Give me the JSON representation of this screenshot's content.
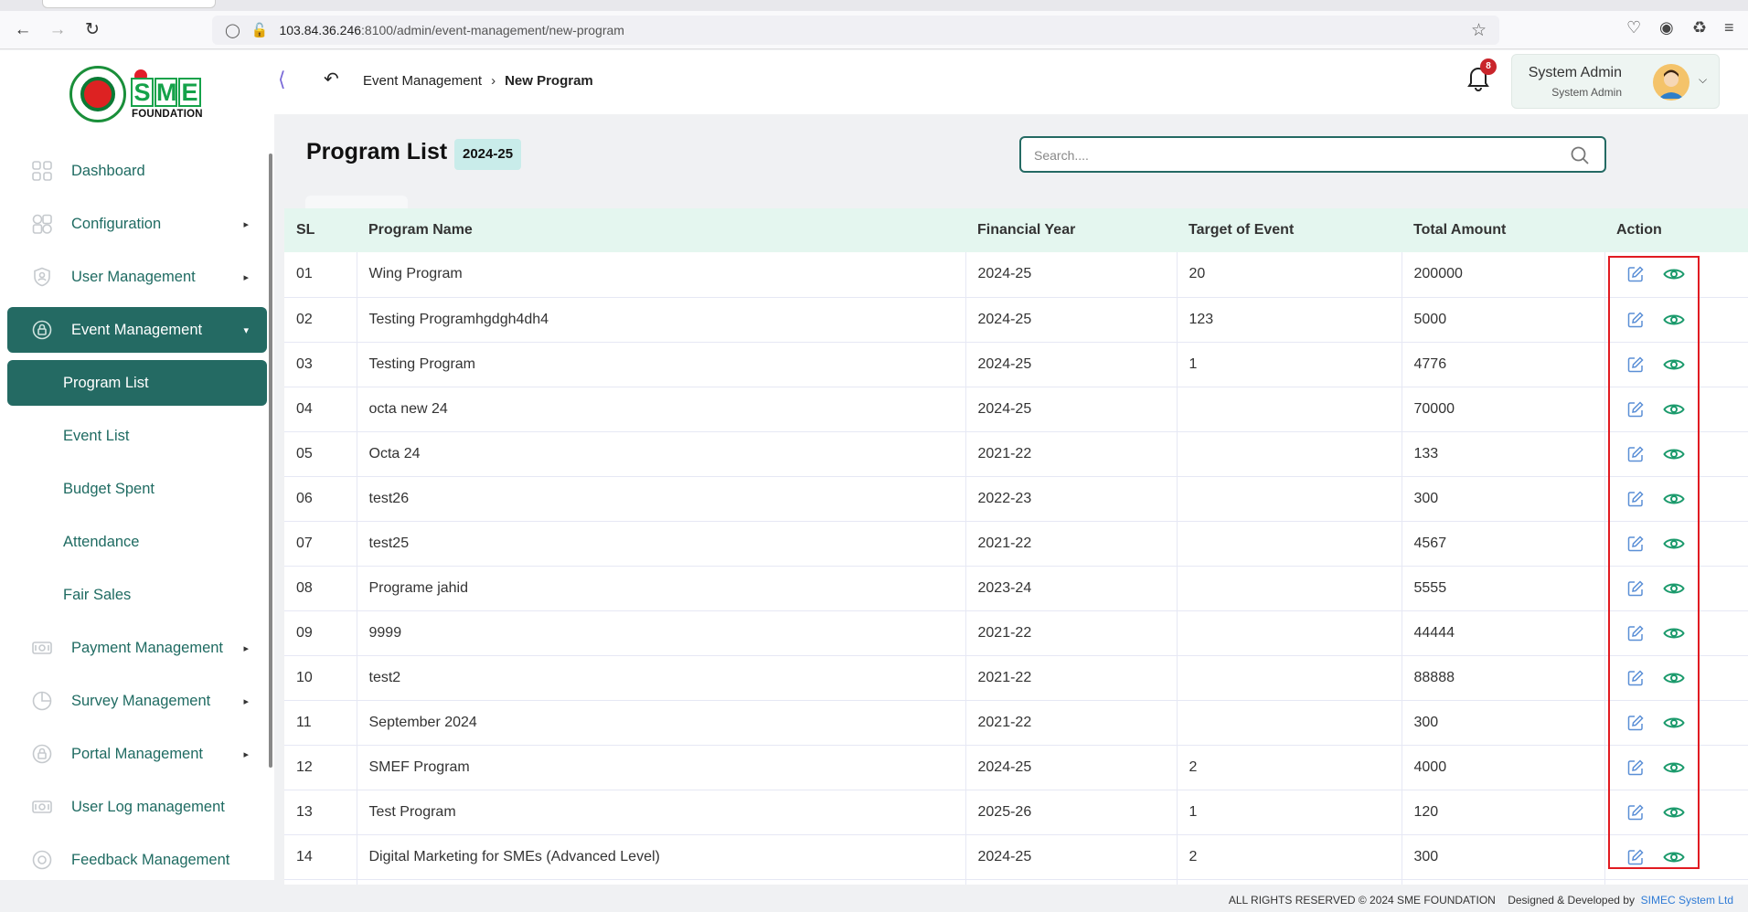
{
  "browser": {
    "url_host": "103.84.36.246",
    "url_rest": ":8100/admin/event-management/new-program"
  },
  "brand": {
    "logo_letters": [
      "S",
      "M",
      "E"
    ],
    "logo_subtitle": "FOUNDATION"
  },
  "sidebar": {
    "items": [
      {
        "label": "Dashboard",
        "icon": "grid-icon",
        "has_arrow": false
      },
      {
        "label": "Configuration",
        "icon": "config-icon",
        "has_arrow": true
      },
      {
        "label": "User Management",
        "icon": "shield-user-icon",
        "has_arrow": true
      },
      {
        "label": "Event Management",
        "icon": "lock-icon",
        "has_arrow": true,
        "active": true
      },
      {
        "label": "Payment Management",
        "icon": "money-icon",
        "has_arrow": true
      },
      {
        "label": "Survey Management",
        "icon": "pie-icon",
        "has_arrow": true
      },
      {
        "label": "Portal Management",
        "icon": "lock-icon",
        "has_arrow": true
      },
      {
        "label": "User Log management",
        "icon": "money-icon",
        "has_arrow": false
      },
      {
        "label": "Feedback Management",
        "icon": "feedback-icon",
        "has_arrow": false
      }
    ],
    "sub_items": [
      {
        "label": "Program List",
        "active": true
      },
      {
        "label": "Event List"
      },
      {
        "label": "Budget Spent"
      },
      {
        "label": "Attendance"
      },
      {
        "label": "Fair Sales"
      }
    ]
  },
  "header": {
    "breadcrumb": [
      "Event Management",
      "New Program"
    ],
    "notification_count": "8",
    "user_name": "System Admin",
    "user_role": "System Admin"
  },
  "main": {
    "title": "Program List",
    "year_chip": "2024-25",
    "search_placeholder": "Search...."
  },
  "table": {
    "columns": [
      "SL",
      "Program Name",
      "Financial Year",
      "Target of Event",
      "Total Amount",
      "Action"
    ],
    "rows": [
      [
        "01",
        "Wing Program",
        "2024-25",
        "20",
        "200000"
      ],
      [
        "02",
        "Testing Programhgdgh4dh4",
        "2024-25",
        "123",
        "5000"
      ],
      [
        "03",
        "Testing Program",
        "2024-25",
        "1",
        "4776"
      ],
      [
        "04",
        "octa new 24",
        "2024-25",
        "",
        "70000"
      ],
      [
        "05",
        "Octa 24",
        "2021-22",
        "",
        "133"
      ],
      [
        "06",
        "test26",
        "2022-23",
        "",
        "300"
      ],
      [
        "07",
        "test25",
        "2021-22",
        "",
        "4567"
      ],
      [
        "08",
        "Programe jahid",
        "2023-24",
        "",
        "5555"
      ],
      [
        "09",
        "9999",
        "2021-22",
        "",
        "44444"
      ],
      [
        "10",
        "test2",
        "2021-22",
        "",
        "88888"
      ],
      [
        "11",
        "September 2024",
        "2021-22",
        "",
        "300"
      ],
      [
        "12",
        "SMEF Program",
        "2024-25",
        "2",
        "4000"
      ],
      [
        "13",
        "Test Program",
        "2025-26",
        "1",
        "120"
      ],
      [
        "14",
        "Digital Marketing for SMEs (Advanced Level)",
        "2024-25",
        "2",
        "300"
      ],
      [
        "",
        "",
        "",
        "",
        ""
      ]
    ]
  },
  "footer": {
    "rights": "ALL RIGHTS RESERVED © 2024 SME FOUNDATION",
    "designed": "Designed & Developed by",
    "company": "SIMEC System Ltd"
  },
  "colors": {
    "primary": "#246a63",
    "header_row": "#e4f6ef",
    "highlight": "#e11b22",
    "edit_icon": "#5b8fd6",
    "view_icon": "#1b9a6c"
  }
}
